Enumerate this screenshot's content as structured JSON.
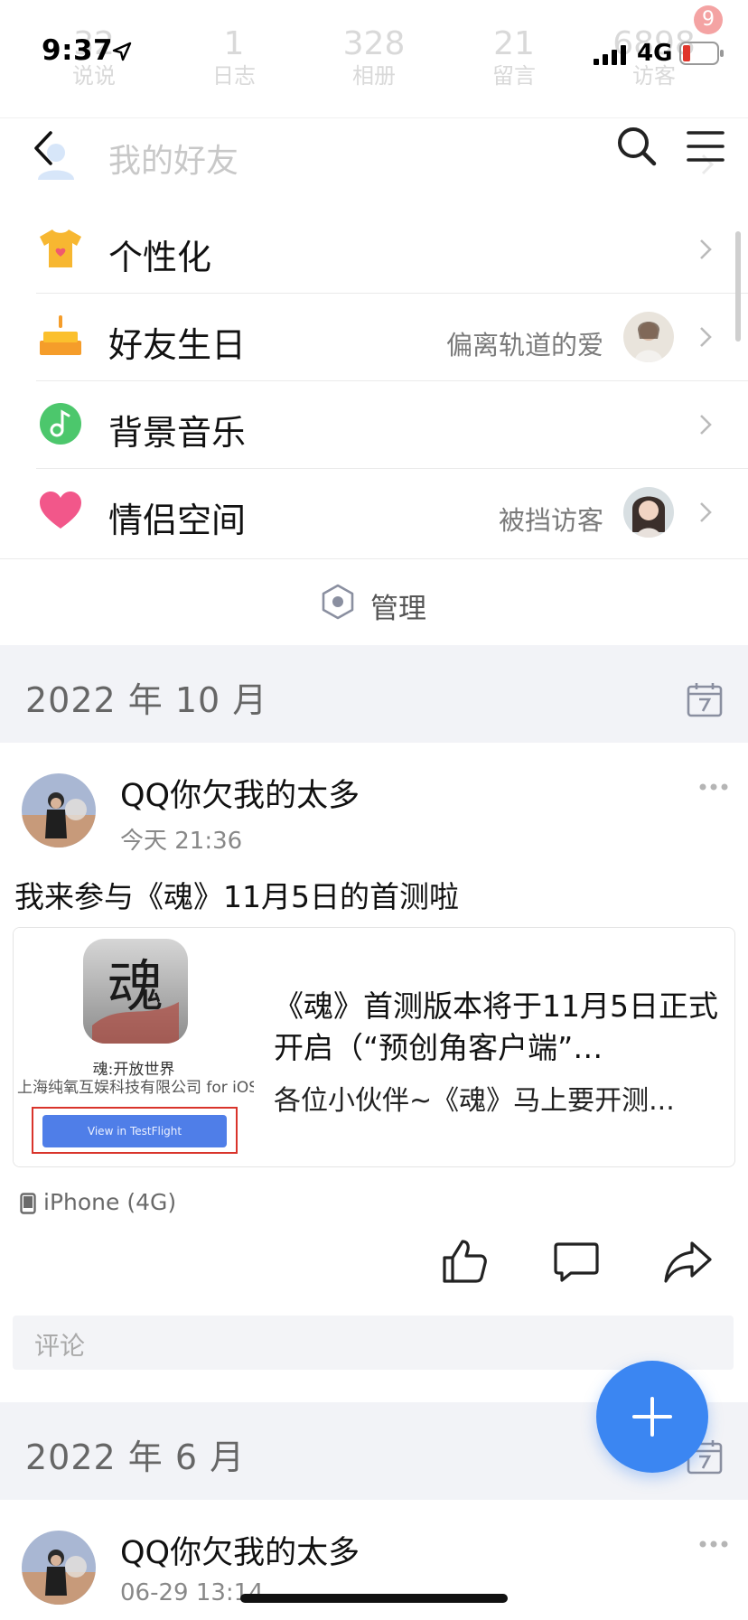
{
  "status_bar": {
    "time": "9:37",
    "network": "4G",
    "notification_count": "9"
  },
  "profile_stats": [
    {
      "num": "32",
      "label": "说说"
    },
    {
      "num": "1",
      "label": "日志"
    },
    {
      "num": "328",
      "label": "相册"
    },
    {
      "num": "21",
      "label": "留言"
    },
    {
      "num": "6898",
      "label": "访客"
    }
  ],
  "nav": {
    "title": "我的好友"
  },
  "settings": [
    {
      "label": "个性化",
      "sub": "",
      "icon": "tshirt-icon"
    },
    {
      "label": "好友生日",
      "sub": "偏离轨道的爱",
      "icon": "cake-icon"
    },
    {
      "label": "背景音乐",
      "sub": "",
      "icon": "music-icon"
    },
    {
      "label": "情侣空间",
      "sub": "被挡访客",
      "icon": "heart-icon"
    }
  ],
  "manage": {
    "label": "管理"
  },
  "sections": [
    {
      "title": "2022 年 10 月"
    },
    {
      "title": "2022 年 6 月"
    }
  ],
  "posts": [
    {
      "author": "QQ你欠我的太多",
      "time": "今天 21:36",
      "text": "我来参与《魂》11月5日的首测啦",
      "card": {
        "app_glyph": "魂",
        "app_name": "魂:开放世界",
        "publisher": "上海纯氧互娱科技有限公司 for iOS",
        "button": "View in TestFlight",
        "title": "《魂》首测版本将于11月5日正式开启（“预创角客户端”…",
        "desc": "各位小伙伴~《魂》马上要开测..."
      },
      "device": "iPhone (4G)",
      "comment_placeholder": "评论"
    },
    {
      "author": "QQ你欠我的太多",
      "time": "06-29 13:14"
    }
  ],
  "colors": {
    "accent": "#3b86f2",
    "section_bg": "#f2f3f7",
    "highlight_box": "#d9342b"
  }
}
